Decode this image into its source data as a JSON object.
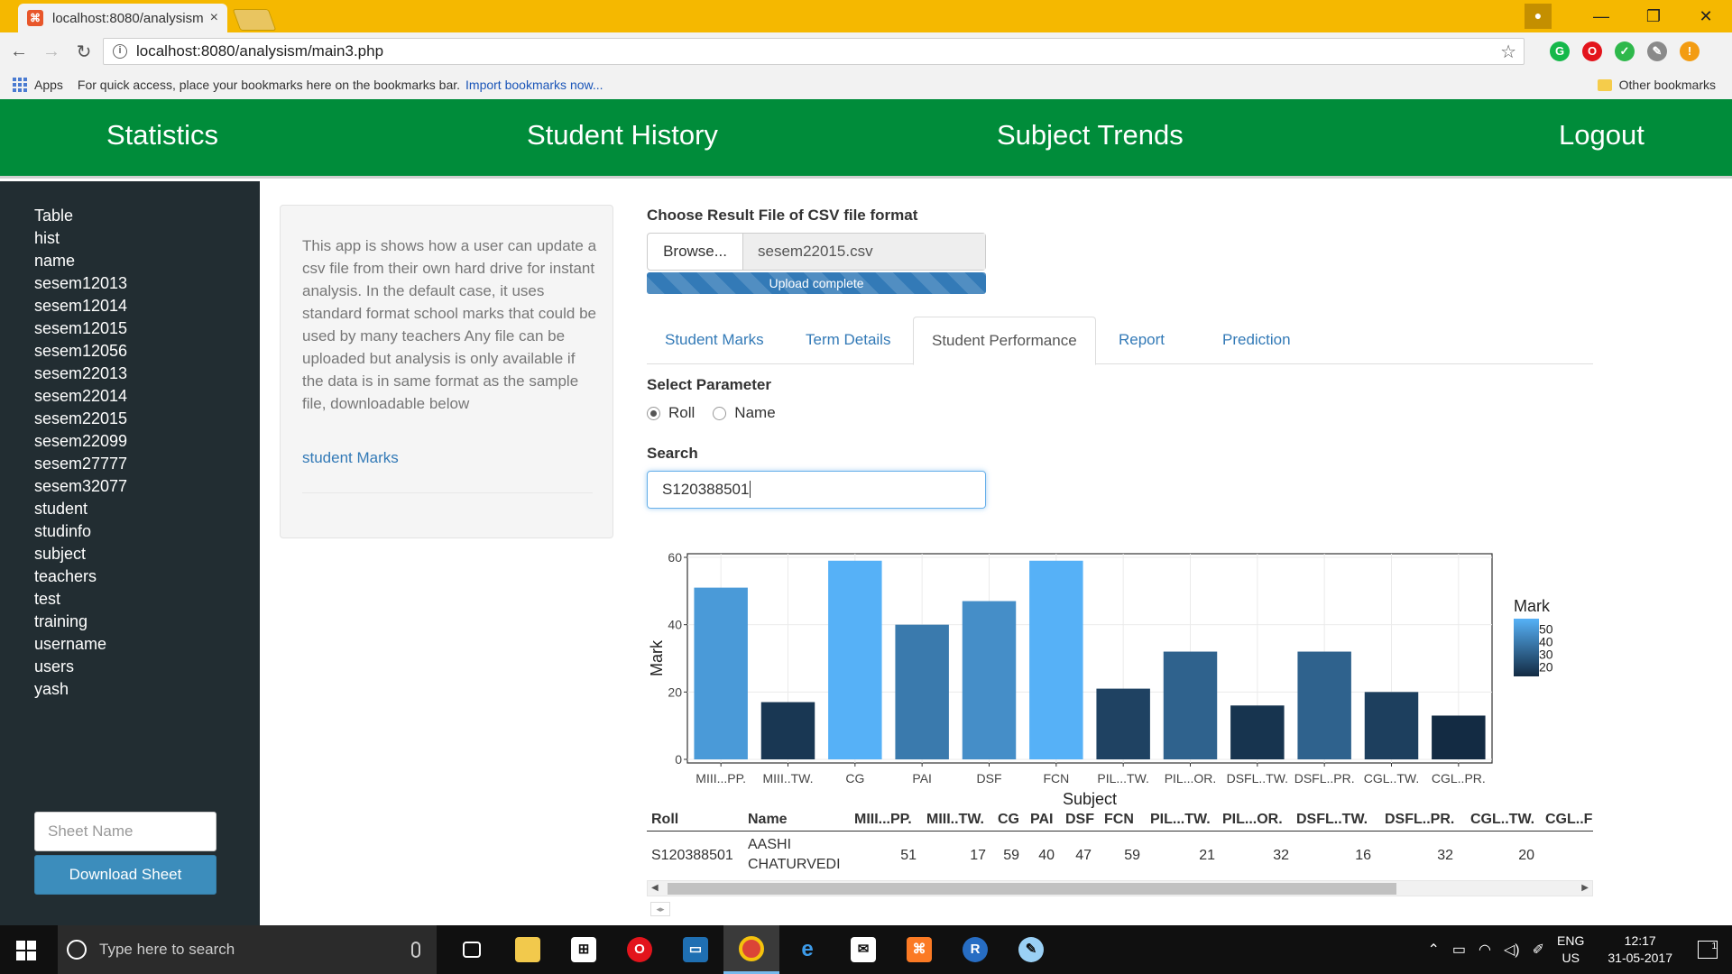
{
  "browser": {
    "tab_title": "localhost:8080/analysism",
    "url": "localhost:8080/analysism/main3.php",
    "bookmarks_apps": "Apps",
    "bookmarks_hint": "For quick access, place your bookmarks here on the bookmarks bar.",
    "bookmarks_import": "Import bookmarks now...",
    "other_bookmarks": "Other bookmarks"
  },
  "nav": {
    "statistics": "Statistics",
    "student_history": "Student History",
    "subject_trends": "Subject Trends",
    "logout": "Logout"
  },
  "sidebar": {
    "items": [
      "Table",
      "hist",
      "name",
      "sesem12013",
      "sesem12014",
      "sesem12015",
      "sesem12056",
      "sesem22013",
      "sesem22014",
      "sesem22015",
      "sesem22099",
      "sesem27777",
      "sesem32077",
      "student",
      "studinfo",
      "subject",
      "teachers",
      "test",
      "training",
      "username",
      "users",
      "yash"
    ],
    "sheet_placeholder": "Sheet Name",
    "download_label": "Download Sheet"
  },
  "info": {
    "text": "This app is shows how a user can update a csv file from their own hard drive for instant analysis. In the default case, it uses standard format school marks that could be used by many teachers Any file can be uploaded but analysis is only available if the data is in same format as the sample file, downloadable below",
    "link": "student Marks"
  },
  "upload": {
    "label": "Choose Result File of CSV file format",
    "browse": "Browse...",
    "file_name": "sesem22015.csv",
    "progress_text": "Upload complete",
    "progress": 1.0
  },
  "tabs": [
    "Student Marks",
    "Term Details",
    "Student Performance",
    "Report",
    "Prediction"
  ],
  "active_tab": "Student Performance",
  "parameter": {
    "label": "Select Parameter",
    "options": [
      "Roll",
      "Name"
    ],
    "selected": "Roll"
  },
  "search": {
    "label": "Search",
    "value": "S120388501"
  },
  "chart_data": {
    "type": "bar",
    "categories": [
      "MIII...PP.",
      "MIII..TW.",
      "CG",
      "PAI",
      "DSF",
      "FCN",
      "PIL...TW.",
      "PIL...OR.",
      "DSFL..TW.",
      "DSFL..PR.",
      "CGL..TW.",
      "CGL..PR."
    ],
    "values": [
      51,
      17,
      59,
      40,
      47,
      59,
      21,
      32,
      16,
      32,
      20,
      13
    ],
    "xlabel": "Subject",
    "ylabel": "Mark",
    "ylim": [
      0,
      60
    ],
    "yticks": [
      0,
      20,
      40,
      60
    ],
    "grid": true,
    "legend": {
      "title": "Mark",
      "ticks": [
        50,
        40,
        30,
        20
      ],
      "placement": "right",
      "color_low": "#132b43",
      "color_high": "#56b1f7"
    }
  },
  "table": {
    "columns": [
      "Roll",
      "Name",
      "MIII...PP.",
      "MIII..TW.",
      "CG",
      "PAI",
      "DSF",
      "FCN",
      "PIL...TW.",
      "PIL...OR.",
      "DSFL..TW.",
      "DSFL..PR.",
      "CGL..TW.",
      "CGL..F"
    ],
    "rows": [
      [
        "S120388501",
        "AASHI",
        "CHATURVEDI",
        "51",
        "17",
        "59",
        "40",
        "47",
        "59",
        "21",
        "32",
        "16",
        "32",
        "20"
      ]
    ]
  },
  "taskbar": {
    "search_placeholder": "Type here to search",
    "lang_1": "ENG",
    "lang_2": "US",
    "time": "12:17",
    "date": "31-05-2017",
    "notifications": "1"
  },
  "colors": {
    "nav_green": "#008c3a",
    "sidebar_bg": "#222d32",
    "accent_blue": "#337ab7",
    "chrome_yellow": "#f5b800"
  }
}
